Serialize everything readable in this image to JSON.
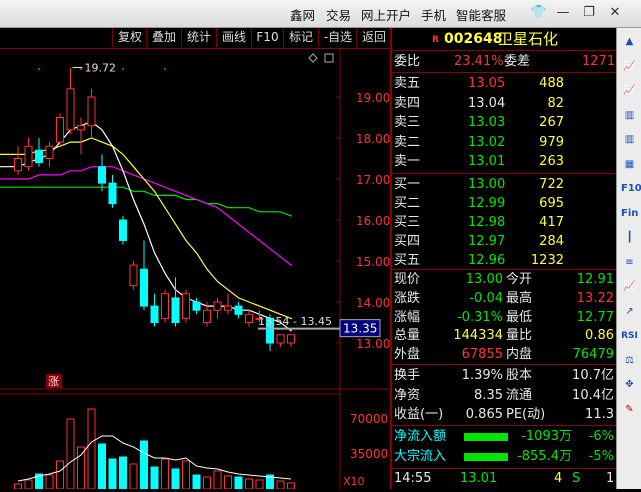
{
  "menu": [
    "鑫网",
    "交易",
    "网上开户",
    "手机",
    "智能客服"
  ],
  "window_buttons": [
    "shirt-icon",
    "minimize-icon",
    "restore-icon",
    "close-icon"
  ],
  "toolbar": [
    "复权",
    "叠加",
    "统计",
    "画线",
    "F10",
    "标记",
    "-自选",
    "返回"
  ],
  "chart": {
    "price_labels": [
      "19.00",
      "18.00",
      "17.00",
      "16.00",
      "15.00",
      "14.00",
      "13.00"
    ],
    "volume_labels": [
      "70000",
      "35000"
    ],
    "volume_unit": "X10",
    "high_marker": "19.72",
    "range_label": "13.54 - 13.45",
    "cursor_price": "13.35",
    "rise_mark": "涨",
    "colors": {
      "up": "#ff3232",
      "down": "#00ffff",
      "ma5": "#ffffff",
      "ma10": "#ffff3c",
      "ma20": "#ff00ff",
      "ma60": "#00e600"
    },
    "candles": [
      {
        "o": 17.2,
        "c": 17.5,
        "h": 17.8,
        "l": 17.1
      },
      {
        "o": 17.3,
        "c": 17.8,
        "h": 18.0,
        "l": 17.2
      },
      {
        "o": 17.7,
        "c": 17.4,
        "h": 18.0,
        "l": 17.3
      },
      {
        "o": 17.5,
        "c": 17.8,
        "h": 17.9,
        "l": 17.3
      },
      {
        "o": 17.9,
        "c": 18.5,
        "h": 18.6,
        "l": 17.8
      },
      {
        "o": 18.2,
        "c": 19.2,
        "h": 19.72,
        "l": 18.1
      },
      {
        "o": 18.2,
        "c": 18.3,
        "h": 18.5,
        "l": 17.6
      },
      {
        "o": 18.3,
        "c": 19.0,
        "h": 19.2,
        "l": 18.0
      },
      {
        "o": 17.3,
        "c": 16.9,
        "h": 17.6,
        "l": 16.7
      },
      {
        "o": 16.9,
        "c": 16.4,
        "h": 17.1,
        "l": 16.3
      },
      {
        "o": 16.0,
        "c": 15.5,
        "h": 16.1,
        "l": 15.4
      },
      {
        "o": 14.4,
        "c": 14.9,
        "h": 15.0,
        "l": 14.3
      },
      {
        "o": 14.8,
        "c": 13.9,
        "h": 15.5,
        "l": 13.8
      },
      {
        "o": 13.9,
        "c": 13.5,
        "h": 14.2,
        "l": 13.4
      },
      {
        "o": 13.6,
        "c": 14.2,
        "h": 14.3,
        "l": 13.5
      },
      {
        "o": 14.1,
        "c": 13.5,
        "h": 14.6,
        "l": 13.4
      },
      {
        "o": 13.6,
        "c": 14.2,
        "h": 14.3,
        "l": 13.5
      },
      {
        "o": 14.0,
        "c": 13.8,
        "h": 14.1,
        "l": 13.7
      },
      {
        "o": 13.5,
        "c": 13.8,
        "h": 14.0,
        "l": 13.4
      },
      {
        "o": 13.8,
        "c": 14.0,
        "h": 14.1,
        "l": 13.6
      },
      {
        "o": 13.8,
        "c": 13.9,
        "h": 14.2,
        "l": 13.7
      },
      {
        "o": 13.9,
        "c": 13.7,
        "h": 14.0,
        "l": 13.6
      },
      {
        "o": 13.5,
        "c": 13.7,
        "h": 13.8,
        "l": 13.4
      },
      {
        "o": 13.6,
        "c": 13.6,
        "h": 13.8,
        "l": 13.5
      },
      {
        "o": 13.6,
        "c": 13.0,
        "h": 13.7,
        "l": 12.8
      },
      {
        "o": 13.0,
        "c": 13.2,
        "h": 13.2,
        "l": 12.9
      },
      {
        "o": 13.0,
        "c": 13.2,
        "h": 13.2,
        "l": 12.9
      }
    ],
    "volumes": [
      5000,
      9000,
      15000,
      14000,
      28000,
      70000,
      42000,
      80000,
      45000,
      30000,
      32000,
      25000,
      48000,
      22000,
      30000,
      20000,
      28000,
      14000,
      12000,
      18000,
      13000,
      12000,
      10000,
      9000,
      14000,
      8000,
      6000
    ],
    "ma5": [
      17.3,
      17.4,
      17.5,
      17.6,
      17.9,
      18.2,
      18.3,
      18.4,
      18.2,
      17.8,
      17.2,
      16.5,
      15.9,
      15.2,
      14.7,
      14.3,
      14.1,
      14.0,
      13.9,
      13.9,
      13.9,
      13.8,
      13.8,
      13.7,
      13.6,
      13.5,
      13.3
    ],
    "ma10": [
      17.6,
      17.6,
      17.7,
      17.7,
      17.8,
      17.9,
      17.9,
      18.0,
      17.9,
      17.8,
      17.6,
      17.3,
      17.0,
      16.7,
      16.3,
      15.9,
      15.5,
      15.2,
      14.8,
      14.5,
      14.3,
      14.1,
      14.0,
      13.9,
      13.8,
      13.7,
      13.6
    ],
    "ma20": [
      17.0,
      17.0,
      17.1,
      17.1,
      17.1,
      17.2,
      17.2,
      17.3,
      17.3,
      17.3,
      17.2,
      17.1,
      17.0,
      16.9,
      16.8,
      16.7,
      16.6,
      16.5,
      16.4,
      16.3,
      16.1,
      15.9,
      15.7,
      15.5,
      15.3,
      15.1,
      14.9
    ],
    "ma60": [
      16.8,
      16.8,
      16.8,
      16.8,
      16.8,
      16.8,
      16.8,
      16.8,
      16.8,
      16.8,
      16.8,
      16.7,
      16.7,
      16.6,
      16.6,
      16.6,
      16.5,
      16.5,
      16.4,
      16.4,
      16.3,
      16.3,
      16.3,
      16.2,
      16.2,
      16.2,
      16.1
    ],
    "mv5": [
      8000,
      10000,
      13000,
      15000,
      18000,
      27000,
      34000,
      47000,
      53000,
      53000,
      46000,
      42000,
      36000,
      31000,
      31000,
      29000,
      31000,
      23000,
      21000,
      20000,
      17000,
      15000,
      14000,
      13000,
      12000,
      11000,
      10000
    ]
  },
  "quote": {
    "badge": "R",
    "code": "002648",
    "name": "卫星石化",
    "weibi_label": "委比",
    "weibi": "23.41%",
    "weicha_label": "委差",
    "weicha": "1271",
    "asks": [
      {
        "label": "卖五",
        "price": "13.05",
        "vol": "488",
        "pcolor": "red"
      },
      {
        "label": "卖四",
        "price": "13.04",
        "vol": "82",
        "pcolor": "white"
      },
      {
        "label": "卖三",
        "price": "13.03",
        "vol": "267",
        "pcolor": "green"
      },
      {
        "label": "卖二",
        "price": "13.02",
        "vol": "979",
        "pcolor": "green"
      },
      {
        "label": "卖一",
        "price": "13.01",
        "vol": "263",
        "pcolor": "green"
      }
    ],
    "bids": [
      {
        "label": "买一",
        "price": "13.00",
        "vol": "722"
      },
      {
        "label": "买二",
        "price": "12.99",
        "vol": "695"
      },
      {
        "label": "买三",
        "price": "12.98",
        "vol": "417"
      },
      {
        "label": "买四",
        "price": "12.97",
        "vol": "284"
      },
      {
        "label": "买五",
        "price": "12.96",
        "vol": "1232"
      }
    ],
    "stats": [
      {
        "l1": "现价",
        "v1": "13.00",
        "c1": "green",
        "l2": "今开",
        "v2": "12.91",
        "c2": "green"
      },
      {
        "l1": "涨跌",
        "v1": "-0.04",
        "c1": "green",
        "l2": "最高",
        "v2": "13.22",
        "c2": "red"
      },
      {
        "l1": "涨幅",
        "v1": "-0.31%",
        "c1": "green",
        "l2": "最低",
        "v2": "12.77",
        "c2": "green"
      },
      {
        "l1": "总量",
        "v1": "144334",
        "c1": "yellow",
        "l2": "量比",
        "v2": "0.86",
        "c2": "yellow"
      },
      {
        "l1": "外盘",
        "v1": "67855",
        "c1": "red",
        "l2": "内盘",
        "v2": "76479",
        "c2": "green"
      }
    ],
    "stats2": [
      {
        "l1": "换手",
        "v1": "1.39%",
        "l2": "股本",
        "v2": "10.7亿"
      },
      {
        "l1": "净资",
        "v1": "8.35",
        "l2": "流通",
        "v2": "10.4亿"
      },
      {
        "l1": "收益(一)",
        "v1": "0.865",
        "l2": "PE(动)",
        "v2": "11.3"
      }
    ],
    "flow": [
      {
        "label": "净流入额",
        "value": "-1093万",
        "pct": "-6%"
      },
      {
        "label": "大宗流入",
        "value": "-855.4万",
        "pct": "-5%"
      }
    ],
    "tick": {
      "time": "14:55",
      "price": "13.01",
      "vol": "4",
      "side": "S",
      "num": "1"
    }
  },
  "right_tools": [
    "up-arrow-icon",
    "chart-icon",
    "chart-icon",
    "bar-chart-icon",
    "bar-chart-icon",
    "grid-icon",
    "f10-icon",
    "fin-icon",
    "candle-icon",
    "list-icon",
    "chart-icon",
    "trend-icon",
    "rsi-icon",
    "scale-icon",
    "move-icon",
    "pen-icon"
  ],
  "right_tool_labels": {
    "f10": "F10",
    "fin": "Fin",
    "rsi": "RSI"
  }
}
